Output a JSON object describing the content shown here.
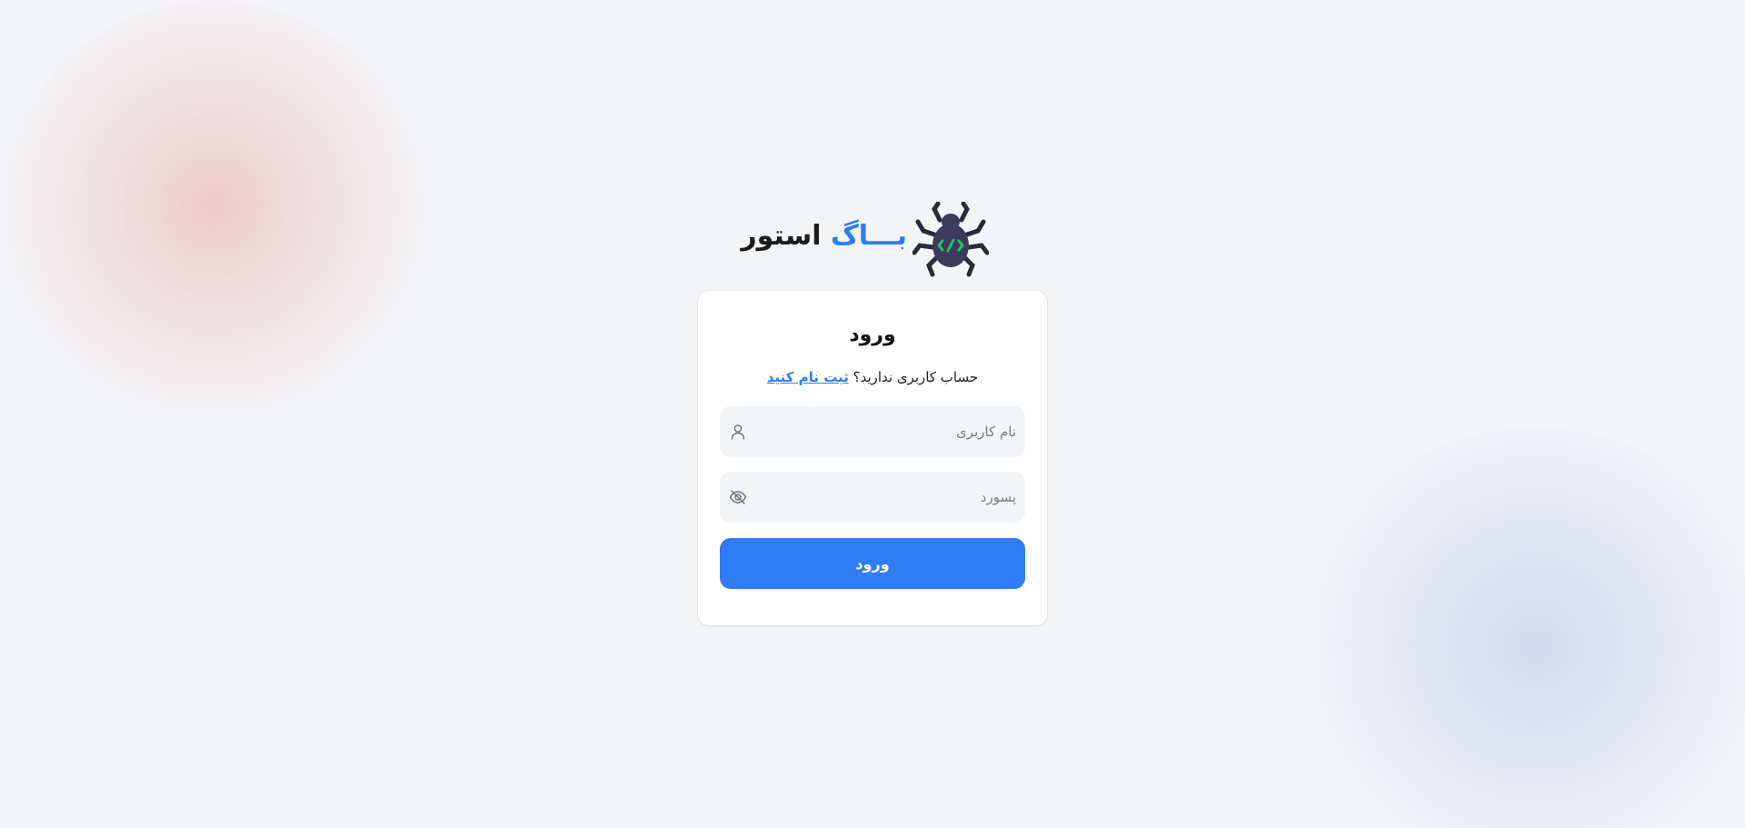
{
  "logo": {
    "brand_blue": "بـــاگ",
    "brand_dark": "استور",
    "icon": "bug-code-icon"
  },
  "login_card": {
    "title": "ورود",
    "signup_prompt": "حساب کاربری ندارید؟",
    "signup_link": "ثبت نام کنید",
    "username": {
      "placeholder": "نام کاربری",
      "value": "",
      "icon": "user-icon"
    },
    "password": {
      "placeholder": "پسورد",
      "value": "",
      "icon": "eye-off-icon"
    },
    "submit_label": "ورود"
  },
  "colors": {
    "accent": "#2f7cf6",
    "background": "#f3f4f6",
    "card": "#ffffff",
    "bug_body": "#3d3a5c",
    "bug_code": "#22c55e"
  }
}
